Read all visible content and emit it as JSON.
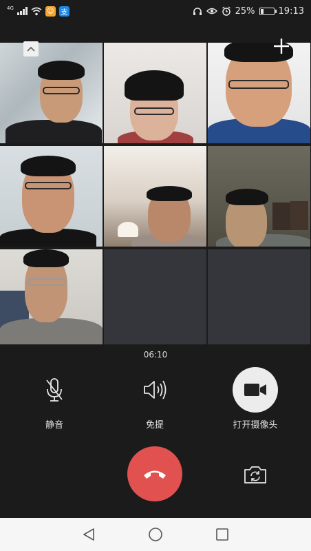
{
  "status_bar": {
    "network": "4G",
    "battery": "25%",
    "battery_level": 0.25,
    "time": "19:13",
    "icons": [
      "signal-icon",
      "wifi-icon",
      "app-notification-icon",
      "alipay-icon",
      "headset-icon",
      "eye-icon",
      "alarm-icon",
      "battery-icon"
    ]
  },
  "call": {
    "duration": "06:10",
    "participants_visible": 7,
    "tiles_total": 9
  },
  "controls": {
    "mute_label": "静音",
    "speaker_label": "免提",
    "camera_label": "打开摄像头"
  },
  "colors": {
    "background": "#1b1b1b",
    "empty_tile": "#34363b",
    "hangup": "#e15150",
    "camera_button": "#ececec",
    "navbar": "#f6f6f6"
  }
}
